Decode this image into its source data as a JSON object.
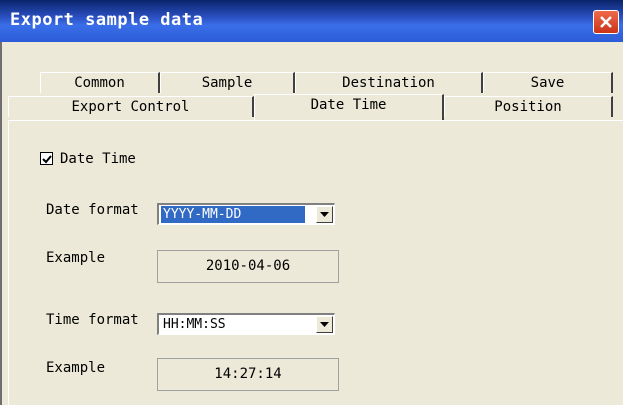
{
  "window": {
    "title": "Export sample data"
  },
  "tabs_row1": [
    "Common",
    "Sample",
    "Destination",
    "Save"
  ],
  "tabs_row2": [
    "Export Control",
    "Date Time",
    "Position"
  ],
  "date_time_checkbox": {
    "label": "Date Time",
    "checked": true
  },
  "date_format": {
    "label": "Date format",
    "value": "YYYY-MM-DD"
  },
  "date_example": {
    "label": "Example",
    "value": "2010-04-06"
  },
  "time_format": {
    "label": "Time format",
    "value": "HH:MM:SS"
  },
  "time_example": {
    "label": "Example",
    "value": "14:27:14"
  },
  "colors": {
    "titlebar": "#2a4fc0",
    "selection": "#316ac5",
    "background": "#ece9d8",
    "close": "#d9472b"
  }
}
